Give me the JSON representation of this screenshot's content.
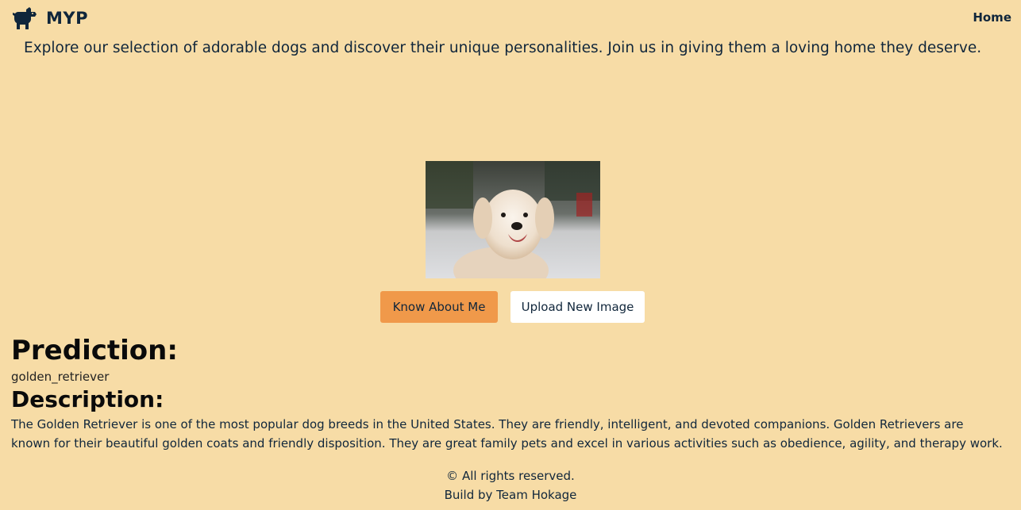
{
  "nav": {
    "brand": "MYP",
    "home_label": "Home",
    "brand_icon": "dog-icon"
  },
  "hero": {
    "tagline": "Explore our selection of adorable dogs and discover their unique personalities. Join us in giving them a loving home they deserve."
  },
  "image": {
    "alt": "Golden retriever dog photo"
  },
  "buttons": {
    "know_about_me": "Know About Me",
    "upload_new_image": "Upload New Image"
  },
  "result": {
    "prediction_heading": "Prediction:",
    "prediction_value": "golden_retriever",
    "description_heading": "Description:",
    "description_text": "The Golden Retriever is one of the most popular dog breeds in the United States. They are friendly, intelligent, and devoted companions. Golden Retrievers are known for their beautiful golden coats and friendly disposition. They are great family pets and excel in various activities such as obedience, agility, and therapy work."
  },
  "footer": {
    "copyright": "© All rights reserved.",
    "credit": "Build by Team Hokage"
  },
  "colors": {
    "background": "#f7dca6",
    "text": "#10263b",
    "accent_button": "#f0994a",
    "secondary_button": "#ffffff"
  }
}
